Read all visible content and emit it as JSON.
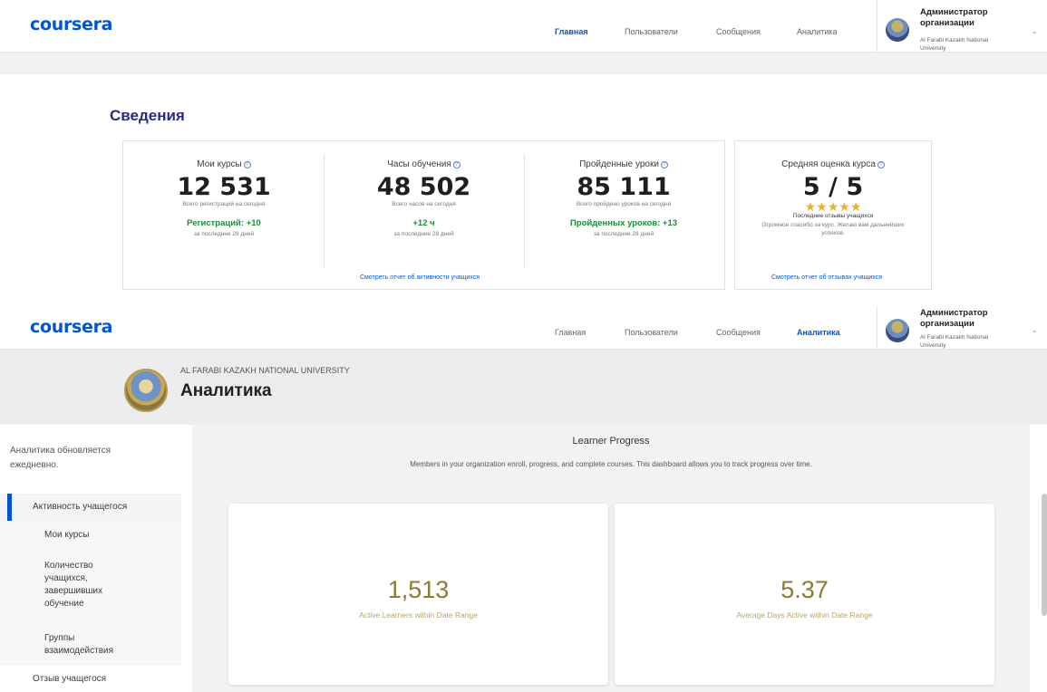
{
  "header_top": {
    "logo": "coursera",
    "nav": [
      "Главная",
      "Пользователи",
      "Сообщения",
      "Аналитика"
    ],
    "active": "Главная",
    "admin_title": "Администратор организации",
    "admin_org": "Al Farabi Kazakh National University"
  },
  "overview": {
    "title": "Сведения",
    "stats": [
      {
        "label": "Мои курсы",
        "value": "12 531",
        "sub": "Всего регистраций на сегодня",
        "delta": "Регистраций: +10",
        "period": "за последние 28 дней"
      },
      {
        "label": "Часы обучения",
        "value": "48 502",
        "sub": "Всего часов на сегодня",
        "delta": "+12 ч",
        "period": "за последние 28 дней"
      },
      {
        "label": "Пройденные уроки",
        "value": "85 111",
        "sub": "Всего пройдено уроков на сегодня",
        "delta": "Пройденных уроков: +13",
        "period": "за последние 28 дней"
      }
    ],
    "activity_link": "Смотреть отчет об активности учащихся",
    "rating": {
      "label": "Средняя оценка курса",
      "value": "5 / 5",
      "stars": 5,
      "reviews_label": "Последние отзывы учащихся",
      "review": "Огромное спасибо за курс. Желаю вам дальнейших успехов.",
      "link": "Смотреть отчет об отзывах учащихся"
    },
    "help_icon": "question-circle-icon"
  },
  "header_bottom": {
    "logo": "coursera",
    "nav": [
      "Главная",
      "Пользователи",
      "Сообщения",
      "Аналитика"
    ],
    "active": "Аналитика",
    "admin_title": "Администратор организации",
    "admin_org": "Al Farabi Kazakh National University"
  },
  "analytics": {
    "university": "AL FARABI KAZAKH NATIONAL UNIVERSITY",
    "title": "Аналитика",
    "sidebar": {
      "info": "Аналитика обновляется ежедневно.",
      "active": "Активность учащегося",
      "sub_items": [
        "Мои курсы",
        "Количество учащихся, завершивших обучение",
        "Группы взаимодействия"
      ],
      "next": "Отзыв учащегося"
    },
    "progress": {
      "title": "Learner Progress",
      "description": "Members in your organization enroll, progress, and complete courses. This dashboard allows you to track progress over time.",
      "metrics": [
        {
          "value": "1,513",
          "label": "Active Learners within Date Range"
        },
        {
          "value": "5.37",
          "label": "Average Days Active within Date Range"
        }
      ]
    }
  },
  "colors": {
    "brand": "#0056d2",
    "positive": "#1f8a3a",
    "star": "#e6b32b",
    "metric": "#8e7a33"
  }
}
